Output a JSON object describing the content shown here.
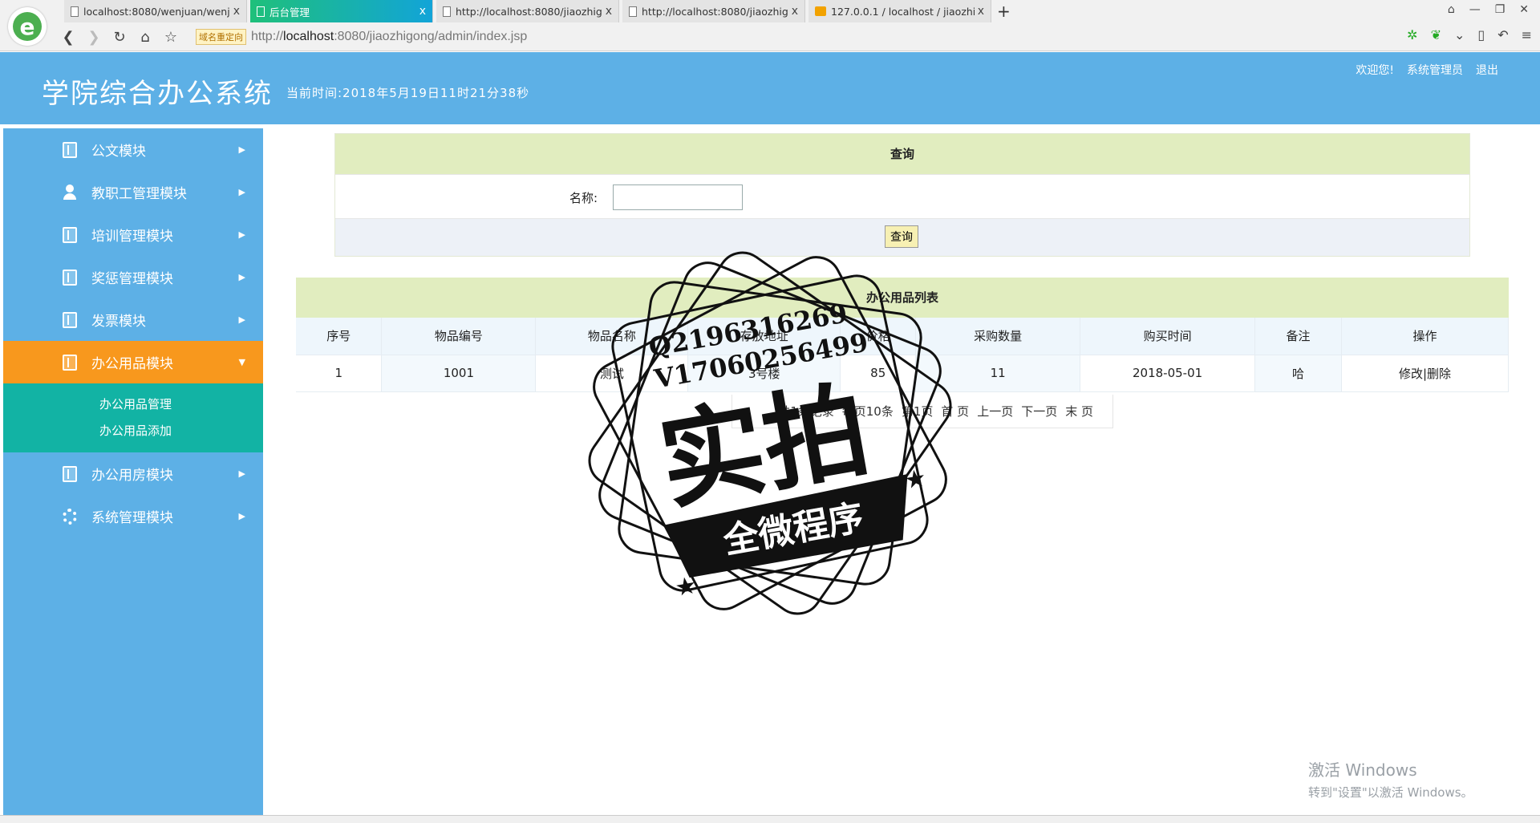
{
  "browser": {
    "tabs": [
      {
        "label": "localhost:8080/wenjuan/wenju",
        "icon": "doc-icon",
        "active": false
      },
      {
        "label": "后台管理",
        "icon": "doc-icon",
        "active": true
      },
      {
        "label": "http://localhost:8080/jiaozhig",
        "icon": "doc-icon",
        "active": false
      },
      {
        "label": "http://localhost:8080/jiaozhig",
        "icon": "doc-icon",
        "active": false
      },
      {
        "label": "127.0.0.1 / localhost / jiaozhi",
        "icon": "pma-icon",
        "active": false
      }
    ],
    "tab_close": "x",
    "new_tab": "+",
    "redirect_badge": "域名重定向",
    "address_host": "localhost",
    "address_prefix": "http://",
    "address_suffix": ":8080/jiaozhigong/admin/index.jsp"
  },
  "header": {
    "title": "学院综合办公系统",
    "time": "当前时间:2018年5月19日11时21分38秒",
    "welcome": "欢迎您!",
    "user": "系统管理员",
    "logout": "退出"
  },
  "sidebar": {
    "items": [
      {
        "label": "公文模块",
        "icon": "book-icon"
      },
      {
        "label": "教职工管理模块",
        "icon": "user-icon"
      },
      {
        "label": "培训管理模块",
        "icon": "book-icon"
      },
      {
        "label": "奖惩管理模块",
        "icon": "book-icon"
      },
      {
        "label": "发票模块",
        "icon": "book-icon"
      },
      {
        "label": "办公用品模块",
        "icon": "book-icon",
        "active": true
      },
      {
        "label": "办公用房模块",
        "icon": "book-icon"
      },
      {
        "label": "系统管理模块",
        "icon": "gear-icon"
      }
    ],
    "submenu": [
      "办公用品管理",
      "办公用品添加"
    ]
  },
  "query": {
    "title": "查询",
    "name_label": "名称:",
    "name_value": "",
    "button": "查询"
  },
  "list": {
    "title": "办公用品列表",
    "columns": [
      "序号",
      "物品编号",
      "物品名称",
      "存放地址",
      "价格",
      "采购数量",
      "购买时间",
      "备注",
      "操作"
    ],
    "rows": [
      [
        "1",
        "1001",
        "测试",
        "3号楼",
        "85",
        "11",
        "2018-05-01",
        "哈"
      ]
    ],
    "edit": "修改",
    "delete": "删除",
    "separator": "|"
  },
  "pager": {
    "summary": "共1条记录",
    "per_page": "每页10条",
    "page_info": "第1页",
    "first": "首 页",
    "prev": "上一页",
    "next": "下一页",
    "last": "末 页"
  },
  "stamp": {
    "line1": "Q2196316269",
    "line2": "V17060256499",
    "big": "实拍",
    "banner": "全微程序"
  },
  "activation": {
    "line1": "激活 Windows",
    "line2": "转到\"设置\"以激活 Windows。"
  }
}
